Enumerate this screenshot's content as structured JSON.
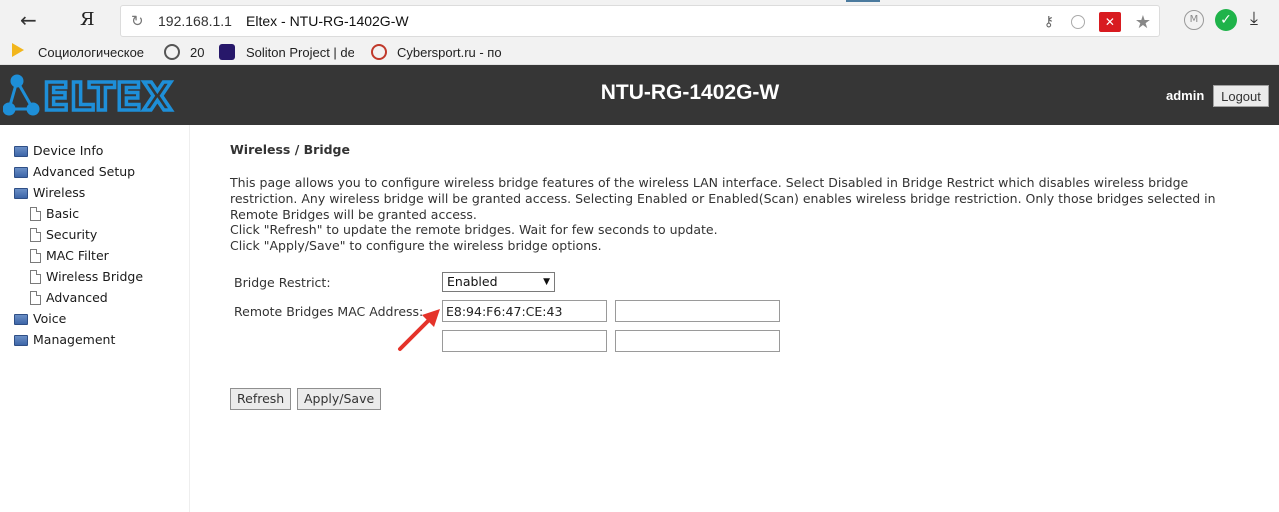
{
  "browser": {
    "back_glyph": "←",
    "ya_glyph": "Я",
    "reload_glyph": "↻",
    "url_host": "192.168.1.1",
    "page_title": "Eltex - NTU-RG-1402G-W",
    "icons": [
      "key-icon",
      "globe-icon",
      "blocked-popup-icon",
      "star-icon",
      "m-icon",
      "check-icon",
      "download-icon"
    ]
  },
  "bookmarks": [
    {
      "label": "Социологическое",
      "icon": "folder-icon"
    },
    {
      "label": "20",
      "icon": "film-icon"
    },
    {
      "label": "Soliton Project | de",
      "icon": "soliton-icon"
    },
    {
      "label": "Cybersport.ru - по",
      "icon": "cybersport-icon"
    }
  ],
  "header": {
    "logo_text": "ELTEX",
    "device_name": "NTU-RG-1402G-W",
    "user": "admin",
    "logout_label": "Logout"
  },
  "sidebar": {
    "items": [
      {
        "label": "Device Info",
        "type": "folder"
      },
      {
        "label": "Advanced Setup",
        "type": "folder"
      },
      {
        "label": "Wireless",
        "type": "folder-open"
      },
      {
        "label": "Basic",
        "type": "page"
      },
      {
        "label": "Security",
        "type": "page"
      },
      {
        "label": "MAC Filter",
        "type": "page"
      },
      {
        "label": "Wireless Bridge",
        "type": "page"
      },
      {
        "label": "Advanced",
        "type": "page"
      },
      {
        "label": "Voice",
        "type": "folder"
      },
      {
        "label": "Management",
        "type": "folder"
      }
    ]
  },
  "main": {
    "title": "Wireless / Bridge",
    "description_lines": [
      "This page allows you to configure wireless bridge features of the wireless LAN interface. Select Disabled in Bridge Restrict which disables wireless bridge restriction. Any wireless bridge will be granted access. Selecting Enabled or Enabled(Scan) enables wireless bridge restriction. Only those bridges selected in Remote Bridges will be granted access.",
      "Click \"Refresh\" to update the remote bridges. Wait for few seconds to update.",
      "Click \"Apply/Save\" to configure the wireless bridge options."
    ],
    "bridge_restrict_label": "Bridge Restrict:",
    "bridge_restrict_value": "Enabled",
    "remote_mac_label": "Remote Bridges MAC Address:",
    "mac_fields": [
      "E8:94:F6:47:CE:43",
      "",
      "",
      ""
    ],
    "refresh_label": "Refresh",
    "apply_label": "Apply/Save"
  },
  "colors": {
    "header_bg": "#363636",
    "logo_blue": "#1e8fd8",
    "annotation_arrow": "#e5332a"
  }
}
